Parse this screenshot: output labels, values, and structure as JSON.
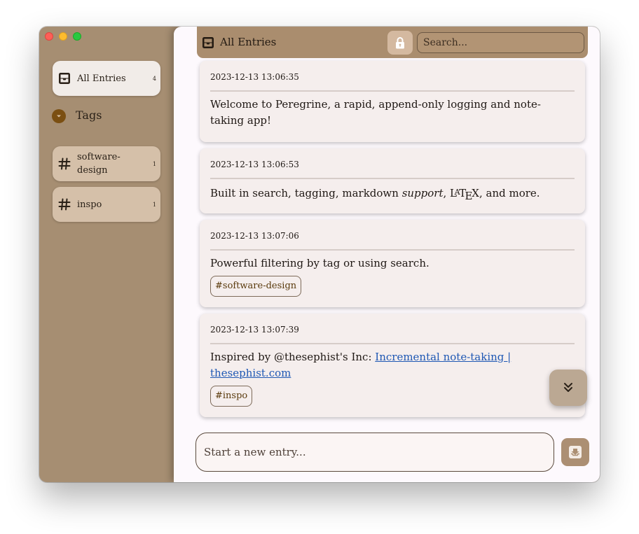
{
  "sidebar": {
    "all_entries": {
      "label": "All Entries",
      "count": "4"
    },
    "tags_title": "Tags",
    "tags": [
      {
        "label": "software-design",
        "count": "1"
      },
      {
        "label": "inspo",
        "count": "1"
      }
    ]
  },
  "header": {
    "title": "All Entries",
    "search_placeholder": "Search..."
  },
  "entries": [
    {
      "timestamp": "2023-12-13 13:06:35",
      "text": "Welcome to Peregrine, a rapid, append-only logging and note-taking app!"
    },
    {
      "timestamp": "2023-12-13 13:06:53",
      "text_before": "Built in search, tagging, markdown ",
      "text_emphasis": "support",
      "text_after": ", and more.",
      "latex": {
        "l": "L",
        "a": "A",
        "t": "T",
        "e": "E",
        "x": "X"
      }
    },
    {
      "timestamp": "2023-12-13 13:07:06",
      "text": "Powerful filtering by tag or using search.",
      "tag": "#software-design"
    },
    {
      "timestamp": "2023-12-13 13:07:39",
      "text": "Inspired by @thesephist's Inc: ",
      "link": "Incremental note-taking | thesephist.com",
      "tag": "#inspo"
    }
  ],
  "composer": {
    "placeholder": "Start a new entry..."
  },
  "colors": {
    "sidebar_bg": "#a68e72",
    "header_bg": "#aa8d6e",
    "card_bg": "#f5eeed",
    "accent": "#7b4f12",
    "link": "#1f58b4"
  },
  "icons": {
    "all_entries": "inbox-icon",
    "tags_toggle": "chevron-down-icon",
    "tag": "hashtag-icon",
    "lock": "lock-icon",
    "scroll": "double-chevron-down-icon",
    "submit": "inbox-download-icon"
  }
}
